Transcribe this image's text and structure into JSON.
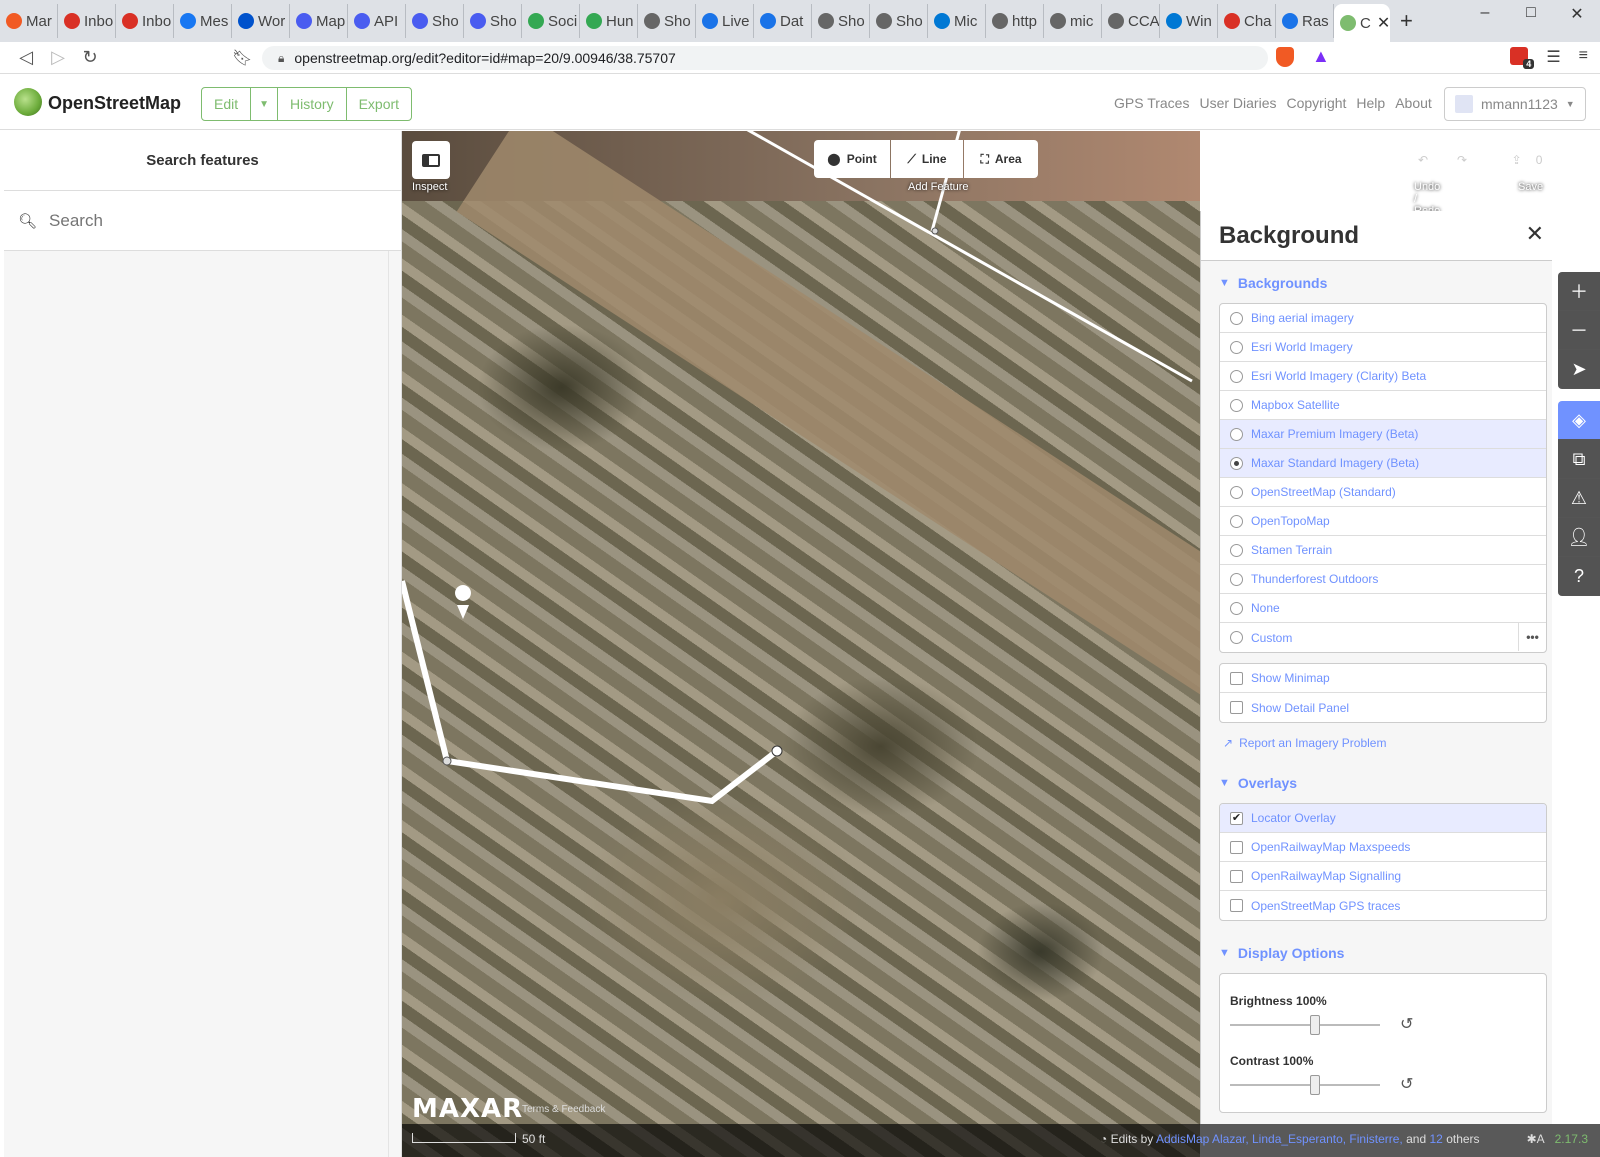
{
  "browser": {
    "tabs": [
      {
        "label": "Mar",
        "color": "#f15a24"
      },
      {
        "label": "Inbo",
        "color": "#d93025"
      },
      {
        "label": "Inbo",
        "color": "#d93025"
      },
      {
        "label": "Mes",
        "color": "#1877f2"
      },
      {
        "label": "Wor",
        "color": "#0052cc"
      },
      {
        "label": "Map",
        "color": "#4a5cf0"
      },
      {
        "label": "API",
        "color": "#4a5cf0"
      },
      {
        "label": "Sho",
        "color": "#4a5cf0"
      },
      {
        "label": "Sho",
        "color": "#4a5cf0"
      },
      {
        "label": "Soci",
        "color": "#34a853"
      },
      {
        "label": "Hun",
        "color": "#34a853"
      },
      {
        "label": "Sho",
        "color": "#666666"
      },
      {
        "label": "Live",
        "color": "#1a73e8"
      },
      {
        "label": "Dat",
        "color": "#1a73e8"
      },
      {
        "label": "Sho",
        "color": "#666666"
      },
      {
        "label": "Sho",
        "color": "#666666"
      },
      {
        "label": "Mic",
        "color": "#0078d4"
      },
      {
        "label": "http",
        "color": "#666666"
      },
      {
        "label": "mic",
        "color": "#666666"
      },
      {
        "label": "CCA",
        "color": "#666666"
      },
      {
        "label": "Win",
        "color": "#0078d4"
      },
      {
        "label": "Cha",
        "color": "#d93025"
      },
      {
        "label": "Ras",
        "color": "#1a73e8"
      }
    ],
    "active_tab": {
      "label": "C",
      "color": "#7ebc6f"
    },
    "url": "openstreetmap.org/edit?editor=id#map=20/9.00946/38.75707",
    "ext_badge": "4"
  },
  "header": {
    "site_name": "OpenStreetMap",
    "edit_label": "Edit",
    "history_label": "History",
    "export_label": "Export",
    "links": [
      "GPS Traces",
      "User Diaries",
      "Copyright",
      "Help",
      "About"
    ],
    "username": "mmann1123"
  },
  "sidebar": {
    "title": "Search features",
    "search_placeholder": "Search"
  },
  "toolbar": {
    "inspect_label": "Inspect",
    "point_label": "Point",
    "line_label": "Line",
    "area_label": "Area",
    "add_feature_label": "Add Feature",
    "undo_redo_label": "Undo / Redo",
    "save_label": "Save",
    "save_count": "0"
  },
  "background_pane": {
    "title": "Background",
    "backgrounds_label": "Backgrounds",
    "backgrounds": [
      {
        "label": "Bing aerial imagery",
        "selected": false,
        "highlight": false
      },
      {
        "label": "Esri World Imagery",
        "selected": false,
        "highlight": false
      },
      {
        "label": "Esri World Imagery (Clarity) Beta",
        "selected": false,
        "highlight": false
      },
      {
        "label": "Mapbox Satellite",
        "selected": false,
        "highlight": false
      },
      {
        "label": "Maxar Premium Imagery (Beta)",
        "selected": false,
        "highlight": true
      },
      {
        "label": "Maxar Standard Imagery (Beta)",
        "selected": true,
        "highlight": true
      },
      {
        "label": "OpenStreetMap (Standard)",
        "selected": false,
        "highlight": false
      },
      {
        "label": "OpenTopoMap",
        "selected": false,
        "highlight": false
      },
      {
        "label": "Stamen Terrain",
        "selected": false,
        "highlight": false
      },
      {
        "label": "Thunderforest Outdoors",
        "selected": false,
        "highlight": false
      },
      {
        "label": "None",
        "selected": false,
        "highlight": false
      },
      {
        "label": "Custom",
        "selected": false,
        "highlight": false
      }
    ],
    "custom_more": "•••",
    "minimap_label": "Show Minimap",
    "detail_panel_label": "Show Detail Panel",
    "report_label": "Report an Imagery Problem",
    "overlays_label": "Overlays",
    "overlays": [
      {
        "label": "Locator Overlay",
        "checked": true
      },
      {
        "label": "OpenRailwayMap Maxspeeds",
        "checked": false
      },
      {
        "label": "OpenRailwayMap Signalling",
        "checked": false
      },
      {
        "label": "OpenStreetMap GPS traces",
        "checked": false
      }
    ],
    "display_label": "Display Options",
    "brightness_label": "Brightness",
    "brightness_value": "100%",
    "brightness_level": 0.5,
    "contrast_label": "Contrast",
    "contrast_value": "100%",
    "contrast_level": 0.5
  },
  "map": {
    "imagery_logo": "MAXAR",
    "terms_label": "Terms & Feedback",
    "scale_label": "50 ft",
    "edits_prefix": "Edits by",
    "edits_users": "AddisMap Alazar, Linda_Esperanto, Finisterre,",
    "edits_and": "and",
    "edits_others_count": "12",
    "edits_others": "others",
    "version": "2.17.3",
    "accent": "#7092ff",
    "osm_green": "#7ebc6f"
  }
}
